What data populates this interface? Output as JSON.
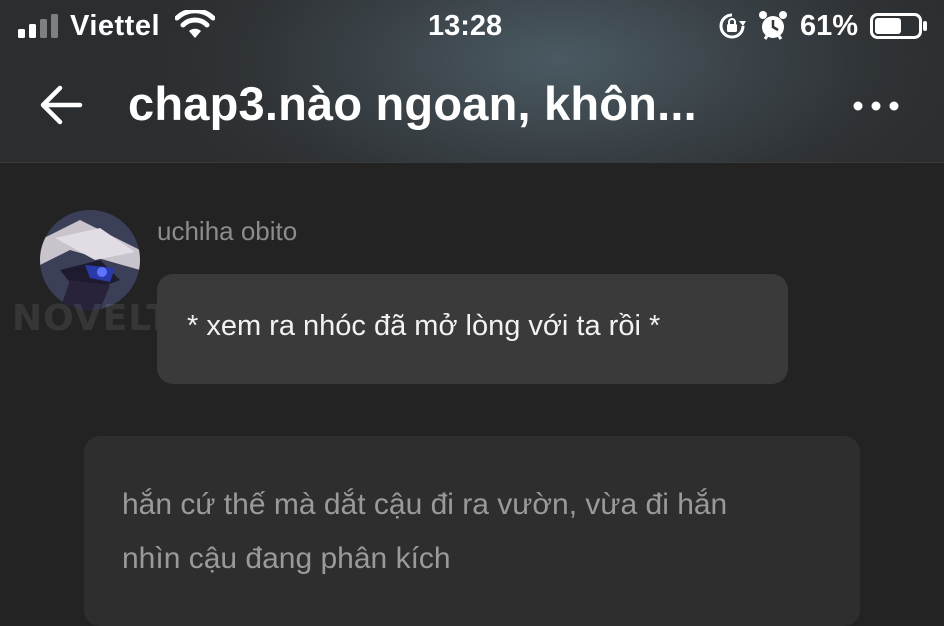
{
  "status_bar": {
    "carrier": "Viettel",
    "time": "13:28",
    "battery_percent": "61%",
    "battery_level": 0.61,
    "icons": [
      "signal-icon",
      "wifi-icon",
      "rotation-lock-icon",
      "alarm-icon",
      "battery-icon"
    ]
  },
  "nav": {
    "title": "chap3.nào ngoan, khôn...",
    "back_icon": "back-arrow-icon",
    "more_icon": "more-dots-icon"
  },
  "watermark": "NOVELTOON",
  "messages": [
    {
      "username": "uchiha obito",
      "text": "* xem ra nhóc đã mở lòng với ta rồi *"
    }
  ],
  "narration": {
    "line1": "hắn cứ thế mà dắt cậu đi ra vườn, vừa đi hắn",
    "line2": "nhìn cậu đang phân kích"
  },
  "colors": {
    "background": "#232323",
    "bubble": "#3a3a3a",
    "narration_bubble": "#2e2e2e",
    "username": "#8c8c8c"
  }
}
